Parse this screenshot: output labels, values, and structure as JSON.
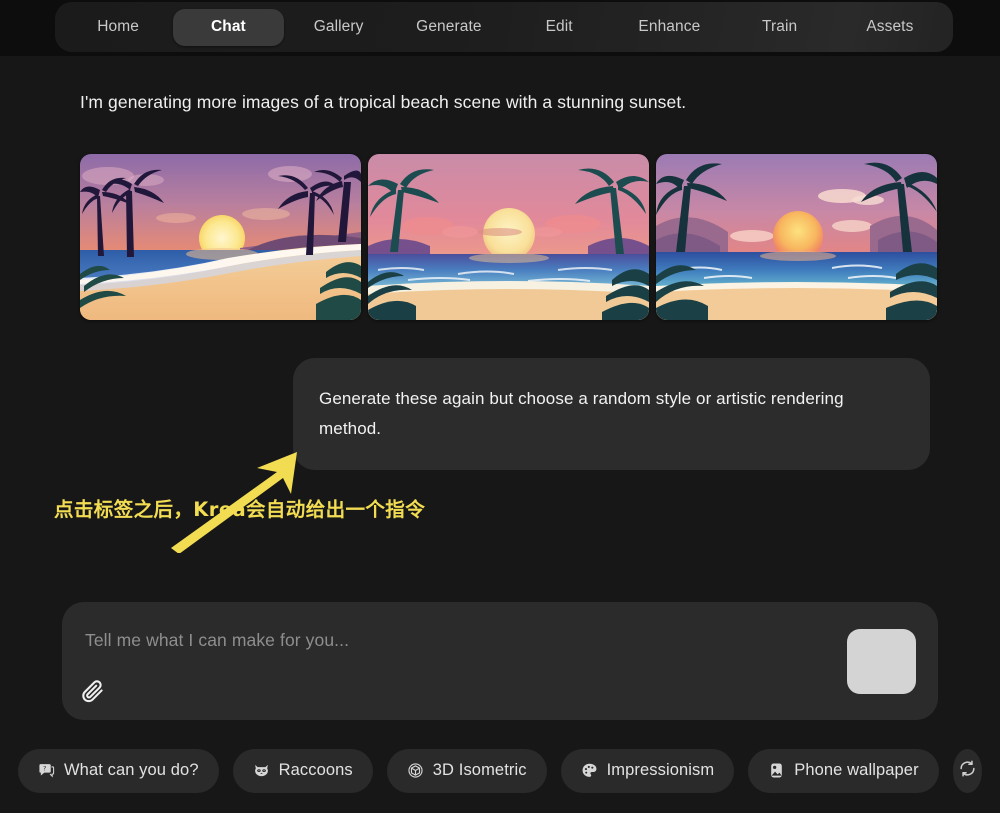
{
  "nav": {
    "tabs": [
      {
        "label": "Home",
        "active": false
      },
      {
        "label": "Chat",
        "active": true
      },
      {
        "label": "Gallery",
        "active": false
      },
      {
        "label": "Generate",
        "active": false
      },
      {
        "label": "Edit",
        "active": false
      },
      {
        "label": "Enhance",
        "active": false
      },
      {
        "label": "Train",
        "active": false
      },
      {
        "label": "Assets",
        "active": false
      }
    ]
  },
  "conversation": {
    "assistant_message": "I'm generating more images of a tropical beach scene with a stunning sunset.",
    "images": [
      {
        "alt": "tropical beach sunset with palm trees on left and right, sun over water, curving shoreline"
      },
      {
        "alt": "tropical beach sunset with large sun centered over ocean, palm trees framing both sides"
      },
      {
        "alt": "tropical beach sunset with orange sun, pink clouds, palm trees and foliage framing"
      }
    ],
    "user_message": "Generate these again but choose a random style or artistic rendering method."
  },
  "annotation": {
    "text": "点击标签之后，Krea会自动给出一个指令",
    "color": "#f2dc52"
  },
  "composer": {
    "placeholder": "Tell me what I can make for you...",
    "attach_icon": "paperclip-icon",
    "send_icon": "send-button"
  },
  "suggestions": {
    "chips": [
      {
        "label": "What can you do?",
        "icon": "question-chat-icon"
      },
      {
        "label": "Raccoons",
        "icon": "raccoon-icon"
      },
      {
        "label": "3D Isometric",
        "icon": "cube-icon"
      },
      {
        "label": "Impressionism",
        "icon": "palette-icon"
      },
      {
        "label": "Phone wallpaper",
        "icon": "phone-icon"
      }
    ],
    "refresh_label": "refresh-icon"
  },
  "colors": {
    "background": "#171717",
    "topbar": "#0d0d0d",
    "bubble": "#2c2c2c",
    "chip": "#2a2a2a",
    "accent_yellow": "#f2dc52",
    "send_button": "#d4d4d4"
  }
}
